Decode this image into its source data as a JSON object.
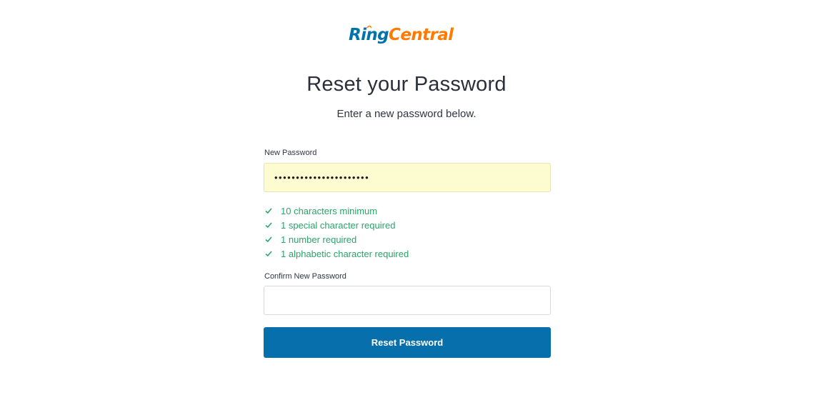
{
  "brand": {
    "logo_part1": "Ring",
    "logo_part2": "Central",
    "colors": {
      "ring": "#0073ae",
      "central": "#ff7a00"
    }
  },
  "page": {
    "title": "Reset your Password",
    "subtitle": "Enter a new password below."
  },
  "form": {
    "new_password_label": "New Password",
    "new_password_value": "••••••••••••••••••••••",
    "requirements": [
      {
        "text": "10 characters minimum",
        "met": true
      },
      {
        "text": "1 special character required",
        "met": true
      },
      {
        "text": "1 number required",
        "met": true
      },
      {
        "text": "1 alphabetic character required",
        "met": true
      }
    ],
    "confirm_password_label": "Confirm New Password",
    "confirm_password_value": "",
    "submit_label": "Reset Password"
  },
  "colors": {
    "accent": "#066fac",
    "success": "#2ba36a",
    "autofill_bg": "#fdfbd0"
  },
  "icons": {
    "requirement_icon": "check-icon"
  }
}
